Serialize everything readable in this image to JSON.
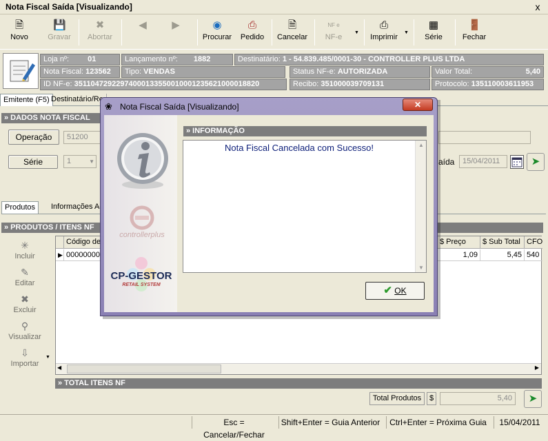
{
  "window": {
    "title": "Nota Fiscal Saída [Visualizando]",
    "close": "x"
  },
  "toolbar": {
    "novo": "Novo",
    "gravar": "Gravar",
    "abortar": "Abortar",
    "procurar": "Procurar",
    "pedido": "Pedido",
    "cancelar": "Cancelar",
    "nfe": "NF-e",
    "nfe_top": "NF e",
    "imprimir": "Imprimir",
    "serie": "Série",
    "fechar": "Fechar"
  },
  "info": {
    "loja_label": "Loja nº:",
    "loja": "01",
    "lancamento_label": "Lançamento nº:",
    "lancamento": "1882",
    "destinatario_label": "Destinatário:",
    "destinatario": "1 - 54.839.485/0001-30 - CONTROLLER PLUS  LTDA",
    "nota_label": "Nota Fiscal:",
    "nota": "123562",
    "tipo_label": "Tipo:",
    "tipo": "VENDAS",
    "status_label": "Status NF-e:",
    "status": "AUTORIZADA",
    "valor_label": "Valor Total:",
    "valor": "5,40",
    "id_label": "ID NF-e:",
    "id": "35110472922974000133550010001235621000018820",
    "recibo_label": "Recibo:",
    "recibo": "351000039709131",
    "protocolo_label": "Protocolo:",
    "protocolo": "135110003611953"
  },
  "tabs": [
    "Emitente (F5)",
    "Destinatário/Re"
  ],
  "dados": {
    "header": "» DADOS NOTA FISCAL",
    "operacao_label": "Operação",
    "operacao": "51200",
    "serie_label": "Série",
    "serie": "1",
    "saida_label": "aída",
    "saida_date": "15/04/2011"
  },
  "produtos_tabs": [
    "Produtos",
    "Informações Ad"
  ],
  "produtos": {
    "header": "» PRODUTOS / ITENS NF",
    "actions": [
      "Incluir",
      "Editar",
      "Excluir",
      "Visualizar",
      "Importar"
    ],
    "columns": [
      "Código de",
      "$ Preço",
      "$ Sub Total",
      "CFO"
    ],
    "rows": [
      {
        "codigo": "00000000",
        "preco": "1,09",
        "subtotal": "5,45",
        "cfo": "540"
      }
    ]
  },
  "total": {
    "header": "» TOTAL ITENS NF",
    "label": "Total Produtos",
    "currency": "$",
    "value": "5,40"
  },
  "statusbar": [
    "Esc = Cancelar/Fechar",
    "Shift+Enter = Guia Anterior",
    "Ctrl+Enter = Próxima Guia",
    "15/04/2011"
  ],
  "modal": {
    "title": "Nota Fiscal Saída [Visualizando]",
    "section": "» INFORMAÇÃO",
    "message": "Nota Fiscal Cancelada com Sucesso!",
    "ok": "OK",
    "brand1": "controllerplus",
    "brand2": "CP-GESTOR",
    "brand2_sub": "RETAIL SYSTEM"
  }
}
